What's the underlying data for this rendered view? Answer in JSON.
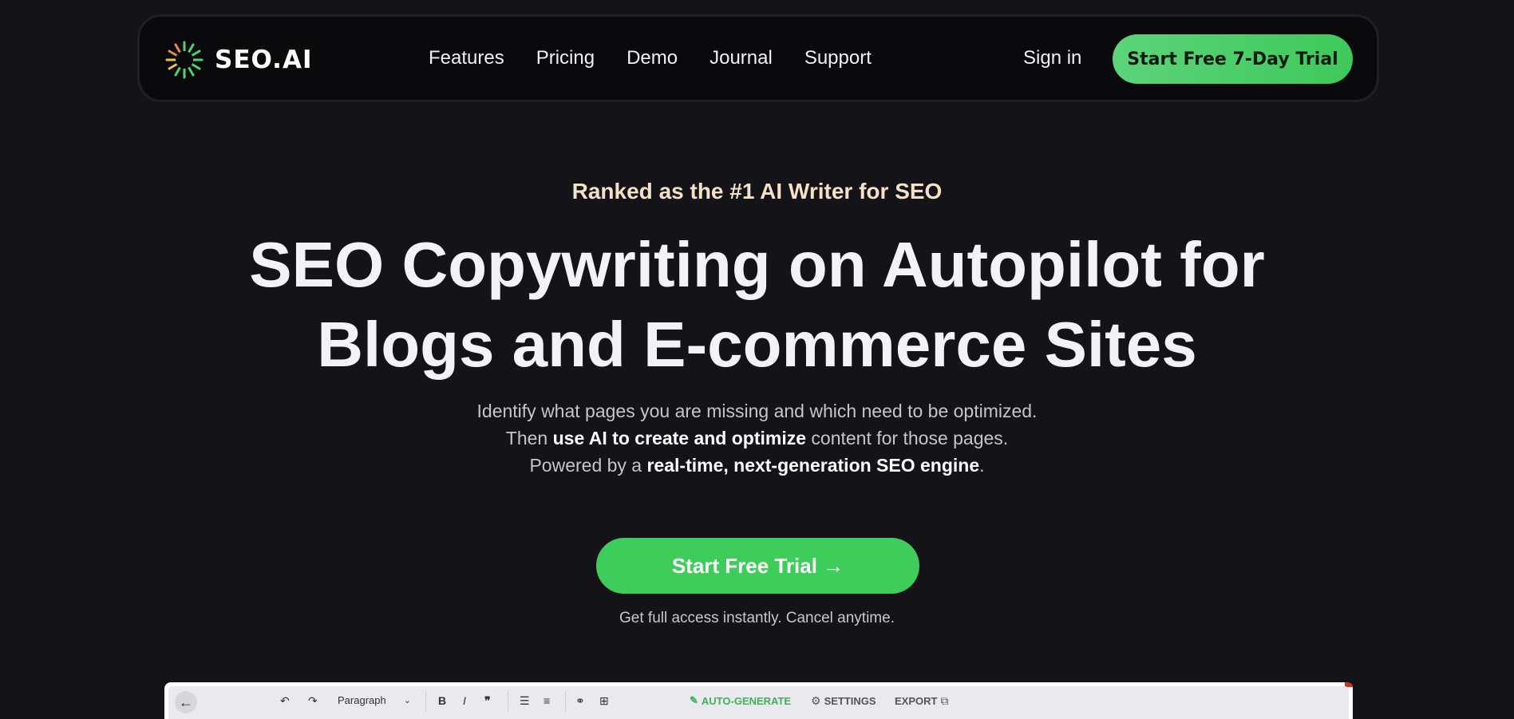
{
  "nav": {
    "logo_text": "SEO.AI",
    "menu": [
      "Features",
      "Pricing",
      "Demo",
      "Journal",
      "Support"
    ],
    "signin": "Sign in",
    "trial_button": "Start Free 7-Day Trial"
  },
  "hero": {
    "tagline": "Ranked as the #1 AI Writer for SEO",
    "headline_line1": "SEO Copywriting on Autopilot for",
    "headline_line2": "Blogs and E-commerce Sites",
    "sub_line1": "Identify what pages you are missing and which need to be optimized.",
    "sub_line2_pre": "Then ",
    "sub_line2_bold": "use AI to create and optimize",
    "sub_line2_post": " content for those pages.",
    "sub_line3_pre": "Powered by a ",
    "sub_line3_bold": "real-time, next-generation SEO engine",
    "sub_line3_post": ".",
    "cta": "Start Free Trial →",
    "cta_note": "Get full access instantly. Cancel anytime."
  },
  "editor": {
    "paragraph_select": "Paragraph",
    "auto_generate": "AUTO-GENERATE",
    "settings": "SETTINGS",
    "export": "EXPORT"
  },
  "colors": {
    "background": "#141318",
    "accent_green": "#3ecd5a",
    "tagline": "#f4e1c8"
  }
}
